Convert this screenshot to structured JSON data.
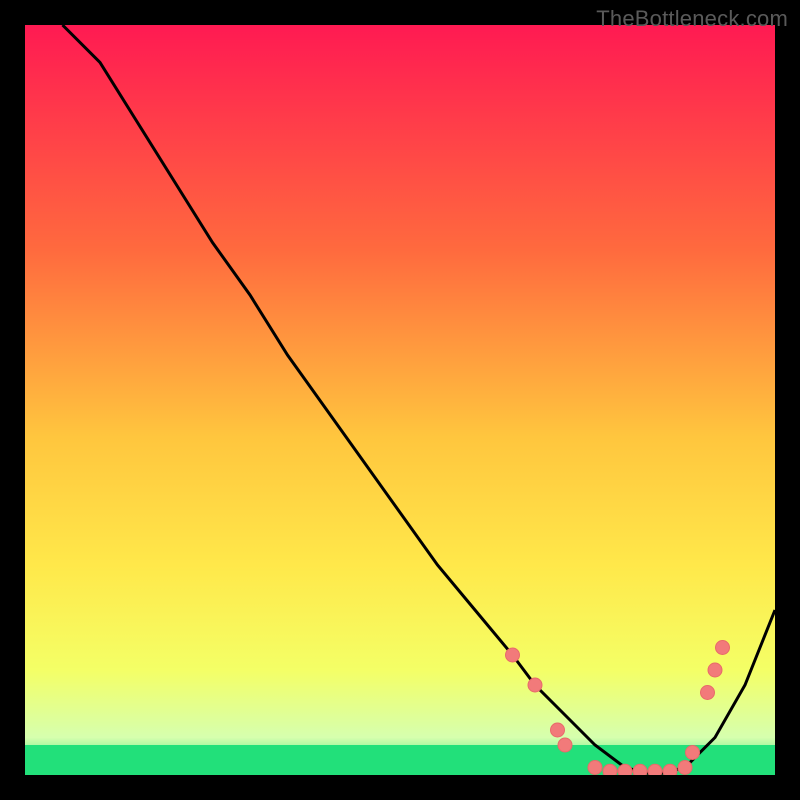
{
  "watermark": "TheBottleneck.com",
  "colors": {
    "frame": "#000000",
    "curve": "#000000",
    "dot_fill": "#f27a7a",
    "dot_stroke": "#e86a6a",
    "optimal_band": "#22e07a"
  },
  "chart_data": {
    "type": "line",
    "title": "",
    "xlabel": "",
    "ylabel": "",
    "xlim": [
      0,
      100
    ],
    "ylim": [
      0,
      100
    ],
    "grid": false,
    "legend": false,
    "background_gradient": {
      "from": "#ff1a52",
      "via1": "#ff8b3e",
      "via2": "#ffe84a",
      "via3": "#f8ff66",
      "to": "#22e07a"
    },
    "optimal_band_y": [
      0,
      4
    ],
    "series": [
      {
        "name": "bottleneck-curve",
        "x": [
          5,
          10,
          15,
          20,
          25,
          30,
          35,
          40,
          45,
          50,
          55,
          60,
          65,
          68,
          72,
          76,
          80,
          84,
          88,
          92,
          96,
          100
        ],
        "y": [
          100,
          95,
          87,
          79,
          71,
          64,
          56,
          49,
          42,
          35,
          28,
          22,
          16,
          12,
          8,
          4,
          1,
          0,
          1,
          5,
          12,
          22
        ]
      }
    ],
    "markers": [
      {
        "x": 65,
        "y": 16
      },
      {
        "x": 68,
        "y": 12
      },
      {
        "x": 71,
        "y": 6
      },
      {
        "x": 72,
        "y": 4
      },
      {
        "x": 76,
        "y": 1
      },
      {
        "x": 78,
        "y": 0.5
      },
      {
        "x": 80,
        "y": 0.5
      },
      {
        "x": 82,
        "y": 0.5
      },
      {
        "x": 84,
        "y": 0.5
      },
      {
        "x": 86,
        "y": 0.5
      },
      {
        "x": 88,
        "y": 1
      },
      {
        "x": 89,
        "y": 3
      },
      {
        "x": 91,
        "y": 11
      },
      {
        "x": 92,
        "y": 14
      },
      {
        "x": 93,
        "y": 17
      }
    ]
  }
}
